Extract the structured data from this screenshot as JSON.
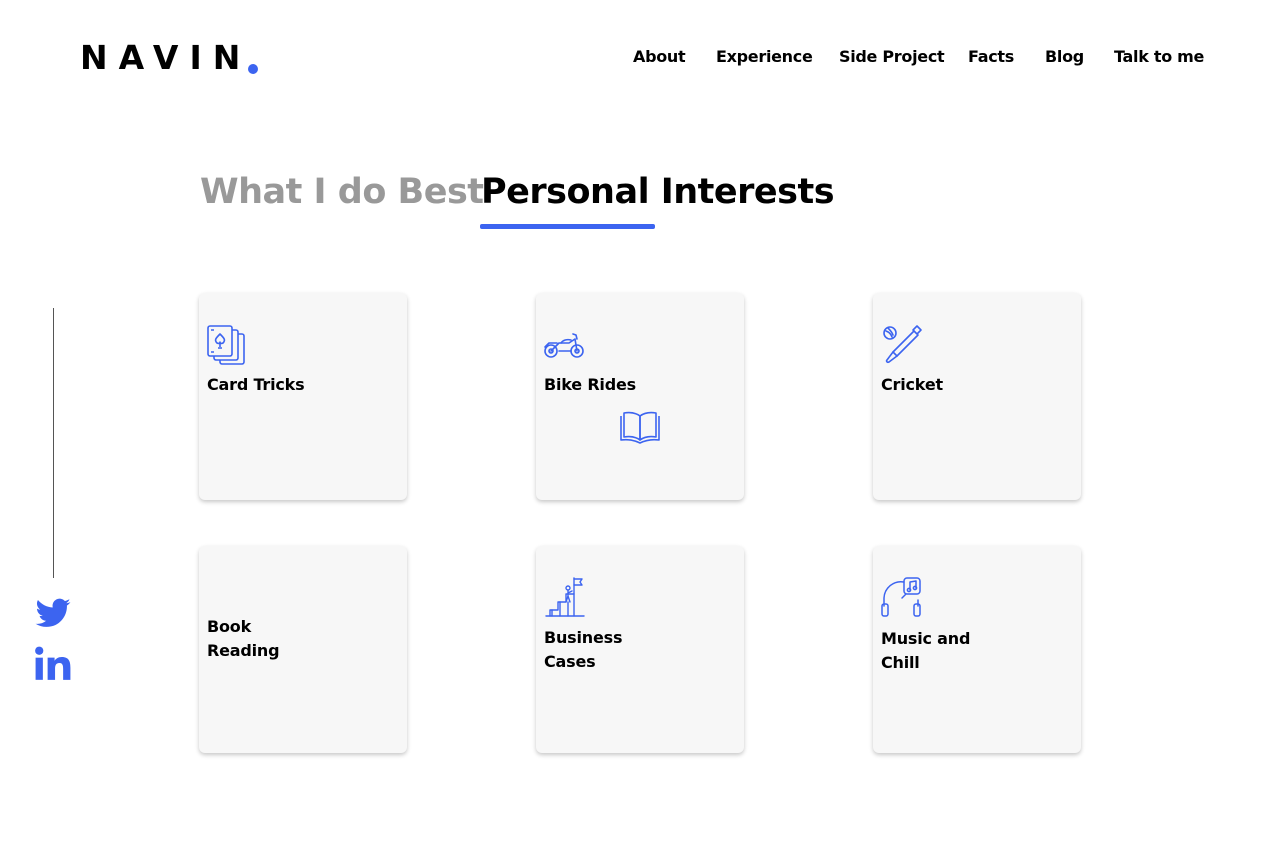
{
  "brand": {
    "name": "NAVIN",
    "accent_color": "#3c64f0"
  },
  "nav": {
    "items": [
      {
        "label": "About"
      },
      {
        "label": "Experience"
      },
      {
        "label": "Side Project"
      },
      {
        "label": "Facts"
      },
      {
        "label": "Blog"
      },
      {
        "label": "Talk to me"
      }
    ]
  },
  "tabs": [
    {
      "label": "What I do Best",
      "active": false
    },
    {
      "label": "Personal Interests",
      "active": true
    }
  ],
  "social": [
    {
      "name": "twitter-icon"
    },
    {
      "name": "linkedin-icon"
    }
  ],
  "interests": [
    {
      "label": "Card Tricks",
      "icon": "playing-cards-icon"
    },
    {
      "label": "Bike Rides",
      "icon": "motorbike-icon"
    },
    {
      "label": "Cricket",
      "icon": "cricket-bat-ball-icon"
    },
    {
      "label": "Book\nReading",
      "icon": "open-book-icon"
    },
    {
      "label": "Business\nCases",
      "icon": "goal-stairs-flag-icon"
    },
    {
      "label": "Music and\nChill",
      "icon": "headphones-music-icon"
    }
  ]
}
